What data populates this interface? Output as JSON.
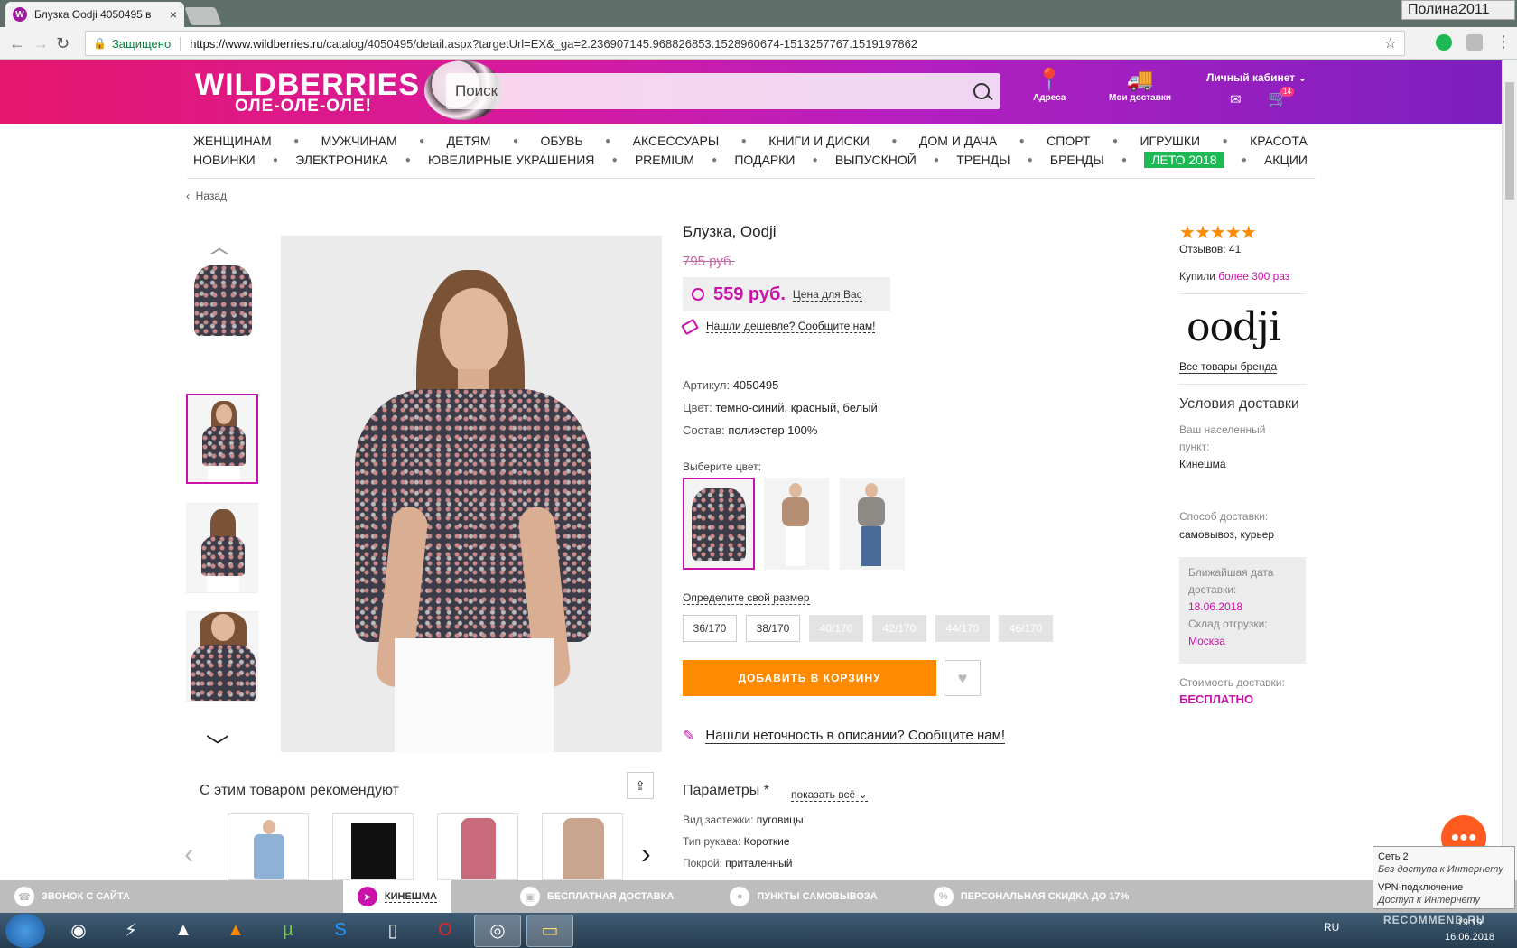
{
  "browser": {
    "tab_title": "Блузка Oodji 4050495 в",
    "tab_favicon": "W",
    "user_name": "Полина2011",
    "secure_label": "Защищено",
    "url_host": "https://www.wildberries.ru",
    "url_path": "/catalog/4050495/detail.aspx?targetUrl=EX&_ga=2.236907145.968826853.1528960674-1513257767.1519197862"
  },
  "header": {
    "logo": "WILDBERRIES",
    "slogan": "ОЛЕ-ОЛЕ-ОЛЕ!",
    "search_placeholder": "Поиск",
    "addresses": "Адреса",
    "deliveries": "Мои доставки",
    "cabinet": "Личный кабинет",
    "cart_count": "14"
  },
  "menu_row1": [
    "ЖЕНЩИНАМ",
    "МУЖЧИНАМ",
    "ДЕТЯМ",
    "ОБУВЬ",
    "АКСЕССУАРЫ",
    "КНИГИ И ДИСКИ",
    "ДОМ И ДАЧА",
    "СПОРТ",
    "ИГРУШКИ",
    "КРАСОТА"
  ],
  "menu_row2": [
    "НОВИНКИ",
    "ЭЛЕКТРОНИКА",
    "ЮВЕЛИРНЫЕ УКРАШЕНИЯ",
    "PREMIUM",
    "ПОДАРКИ",
    "ВЫПУСКНОЙ",
    "ТРЕНДЫ",
    "БРЕНДЫ",
    "ЛЕТО 2018",
    "АКЦИИ"
  ],
  "menu_highlight": "ЛЕТО 2018",
  "back": "Назад",
  "product": {
    "name": "Блузка, Oodji",
    "old_price": "795 руб.",
    "price": "559 руб.",
    "price_note": "Цена для Вас",
    "cheaper": "Нашли дешевле? Сообщите нам!",
    "article_label": "Артикул:",
    "article": "4050495",
    "color_label": "Цвет:",
    "color": "темно-синий, красный, белый",
    "composition_label": "Состав:",
    "composition": "полиэстер 100%",
    "choose_color": "Выберите цвет:",
    "size_label": "Определите свой размер",
    "sizes": [
      {
        "label": "36/170",
        "available": true
      },
      {
        "label": "38/170",
        "available": true
      },
      {
        "label": "40/170",
        "available": false
      },
      {
        "label": "42/170",
        "available": false
      },
      {
        "label": "44/170",
        "available": false
      },
      {
        "label": "46/170",
        "available": false
      }
    ],
    "add_to_cart": "ДОБАВИТЬ В КОРЗИНУ",
    "inaccuracy": "Нашли неточность в описании? Сообщите нам!",
    "params_title": "Параметры *",
    "show_all": "показать всё",
    "params": [
      {
        "label": "Вид застежки:",
        "value": "пуговицы"
      },
      {
        "label": "Тип рукава:",
        "value": "Короткие"
      },
      {
        "label": "Покрой:",
        "value": "приталенный"
      }
    ]
  },
  "side": {
    "rating_stars": 5,
    "reviews": "Отзывов: 41",
    "bought_prefix": "Купили",
    "bought_value": "более 300 раз",
    "brand_logo": "oodji",
    "brand_all": "Все товары бренда",
    "delivery_title": "Условия доставки",
    "locality_label": "Ваш населенный пункт:",
    "locality": "Кинешма",
    "method_label": "Способ доставки:",
    "method": "самовывоз, курьер",
    "nearest_label": "Ближайшая дата доставки:",
    "nearest_date": "18.06.2018",
    "warehouse_label": "Склад отгрузки:",
    "warehouse": "Москва",
    "cost_label": "Стоимость доставки:",
    "cost": "БЕСПЛАТНО"
  },
  "recommend_title": "С этим товаром рекомендуют",
  "bottom_bar": [
    {
      "label": "ЗВОНОК С САЙТА",
      "icon": "phone-icon"
    },
    {
      "label": "КИНЕШМА",
      "icon": "location-arrow-icon",
      "active": true
    },
    {
      "label": "БЕСПЛАТНАЯ ДОСТАВКА",
      "icon": "truck-icon"
    },
    {
      "label": "ПУНКТЫ САМОВЫВОЗА",
      "icon": "pin-icon"
    },
    {
      "label": "ПЕРСОНАЛЬНАЯ СКИДКА ДО 17%",
      "icon": "percent-tag-icon"
    }
  ],
  "tooltip": {
    "line1": "Сеть  2",
    "line2": "Без доступа к Интернету",
    "line3": "VPN-подключение",
    "line4": "Доступ к Интернету"
  },
  "taskbar": {
    "lang": "RU",
    "time": "19:19",
    "date": "16.06.2018",
    "watermark": "RECOMMEND.RU"
  },
  "colors": {
    "accent": "#cb11ab",
    "orange": "#ff8a00",
    "green": "#1db954"
  }
}
